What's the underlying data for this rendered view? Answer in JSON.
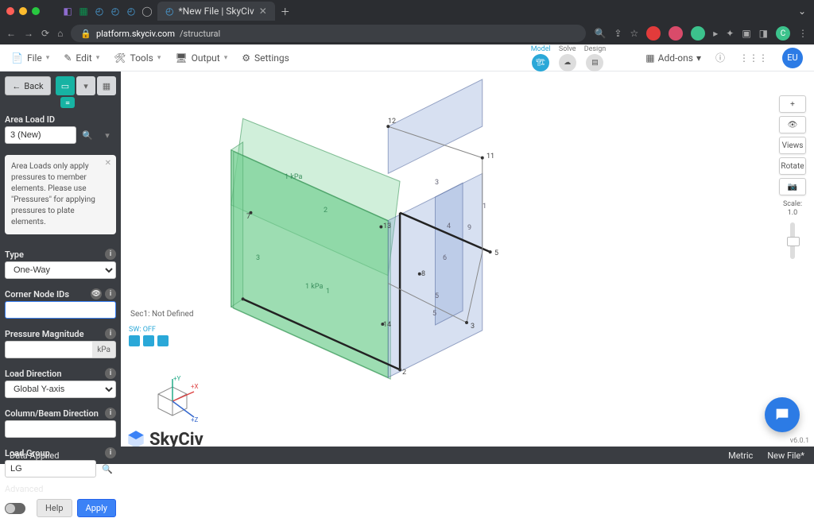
{
  "browser": {
    "tabs": {
      "active_title": "*New File | SkyCiv"
    },
    "url_host": "platform.skyciv.com",
    "url_path": "/structural",
    "avatar_badge": "C"
  },
  "menubar": {
    "file": "File",
    "edit": "Edit",
    "tools": "Tools",
    "output": "Output",
    "settings": "Settings",
    "addons": "Add-ons",
    "modes": {
      "model": "Model",
      "solve": "Solve",
      "design": "Design"
    },
    "user_avatar": "EU"
  },
  "panel": {
    "back": "Back",
    "id_label": "Area Load ID",
    "id_value": "3 (New)",
    "info": "Area Loads only apply pressures to member elements. Please use \"Pressures\" for applying pressures to plate elements.",
    "type_label": "Type",
    "type_value": "One-Way",
    "corner_label": "Corner Node IDs",
    "corner_value": "",
    "mag_label": "Pressure Magnitude",
    "mag_value": "",
    "mag_unit": "kPa",
    "dir_label": "Load Direction",
    "dir_value": "Global Y-axis",
    "column_label": "Column/Beam Direction",
    "column_value": "",
    "group_label": "Load Group",
    "group_value": "LG",
    "advanced_label": "Advanced",
    "help_btn": "Help",
    "apply_btn": "Apply"
  },
  "canvas": {
    "section_label": "Sec1: Not Defined",
    "sw": "SW: OFF",
    "load_left": "1 kPa",
    "load_bottom": "1 kPa",
    "nodes": {
      "n2": "2",
      "n3": "3",
      "n5": "5",
      "n7": "7",
      "n8": "8",
      "n11": "11",
      "n12": "12",
      "n13": "13",
      "n14": "14"
    },
    "right_edges": {
      "e1r": "1",
      "e3r": "3",
      "e4r": "4",
      "e5r": "5",
      "e5r2": "5",
      "e6r": "6",
      "e9r": "9"
    },
    "left_edges": {
      "e1l": "1",
      "e2l": "2",
      "e3l": "3"
    },
    "logo_text": "SkyCiv",
    "version": "v6.0.1",
    "axis": {
      "x": "+X",
      "y": "+Y",
      "z": "+Z"
    }
  },
  "floating": {
    "zoom_in": "+",
    "views": "Views",
    "rotate": "Rotate",
    "scale_label": "Scale:",
    "scale_value": "1.0"
  },
  "status": {
    "left": "Data Applied",
    "metric": "Metric",
    "file": "New File*"
  }
}
